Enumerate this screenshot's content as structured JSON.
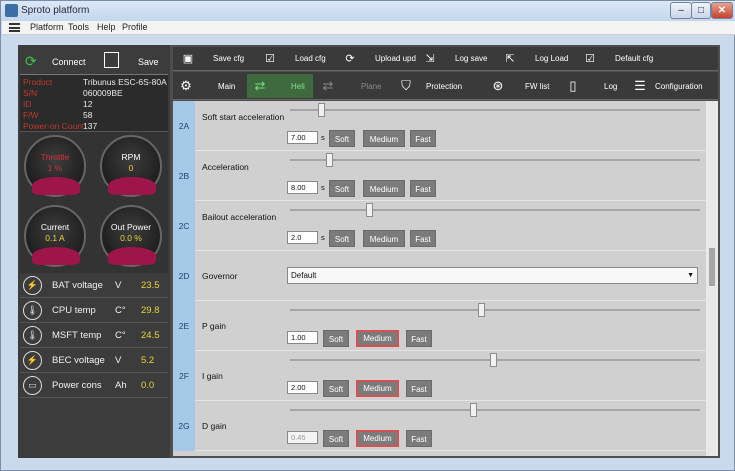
{
  "window": {
    "title": "Sproto platform",
    "btn_min": "–",
    "btn_max": "□",
    "btn_close": "✕"
  },
  "menu": [
    "Platform",
    "Tools",
    "Help",
    "Profile"
  ],
  "left": {
    "connect_label": "Connect",
    "save_label": "Save",
    "info": [
      {
        "key": "Product",
        "value": "Tribunus ESC-6S-80A"
      },
      {
        "key": "S/N",
        "value": "060009BE"
      },
      {
        "key": "ID",
        "value": "12"
      },
      {
        "key": "F/W",
        "value": "58"
      },
      {
        "key": "Power-on Count",
        "value": "137"
      }
    ],
    "gauges": [
      {
        "label": "Throttle",
        "value": "1 %",
        "label_color": "#d0303a"
      },
      {
        "label": "RPM",
        "value": "0",
        "label_color": "#ffffff"
      },
      {
        "label": "Current",
        "value": "0.1 A",
        "label_color": "#ffffff"
      },
      {
        "label": "Out Power",
        "value": "0.0 %",
        "label_color": "#ffffff"
      }
    ],
    "stats": [
      {
        "icon": "BAT",
        "label": "BAT voltage",
        "unit": "V",
        "value": "23.5"
      },
      {
        "icon": "CPU",
        "label": "CPU temp",
        "unit": "C°",
        "value": "29.8"
      },
      {
        "icon": "FET",
        "label": "MSFT temp",
        "unit": "C°",
        "value": "24.5"
      },
      {
        "icon": "BEC",
        "label": "BEC voltage",
        "unit": "V",
        "value": "5.2"
      },
      {
        "icon": "PWR",
        "label": "Power cons",
        "unit": "Ah",
        "value": "0.0"
      }
    ]
  },
  "toolbar": [
    "Save cfg",
    "Load cfg",
    "Upload upd",
    "Log save",
    "Log Load",
    "Default cfg"
  ],
  "tabs": [
    "Main",
    "Heli",
    "Plane",
    "Protection",
    "FW list",
    "Log",
    "Configuration"
  ],
  "buttons": {
    "soft": "Soft",
    "medium": "Medium",
    "fast": "Fast"
  },
  "params": [
    {
      "id": "2A",
      "name": "Soft start acceleration",
      "value": "7.00",
      "unit": "s",
      "slider": 0.07,
      "selected": ""
    },
    {
      "id": "2B",
      "name": "Acceleration",
      "value": "8.00",
      "unit": "s",
      "slider": 0.09,
      "selected": ""
    },
    {
      "id": "2C",
      "name": "Bailout acceleration",
      "value": "2.0",
      "unit": "s",
      "slider": 0.19,
      "selected": ""
    },
    {
      "id": "2D",
      "name": "Governor",
      "select": "Default"
    },
    {
      "id": "2E",
      "name": "P gain",
      "value": "1.00",
      "unit": "",
      "slider": 0.47,
      "selected": "medium"
    },
    {
      "id": "2F",
      "name": "I gain",
      "value": "2.00",
      "unit": "",
      "slider": 0.5,
      "selected": "medium"
    },
    {
      "id": "2G",
      "name": "D gain",
      "value": "0.45",
      "unit": "",
      "slider": 0.45,
      "selected": "medium",
      "disabled": true
    }
  ]
}
